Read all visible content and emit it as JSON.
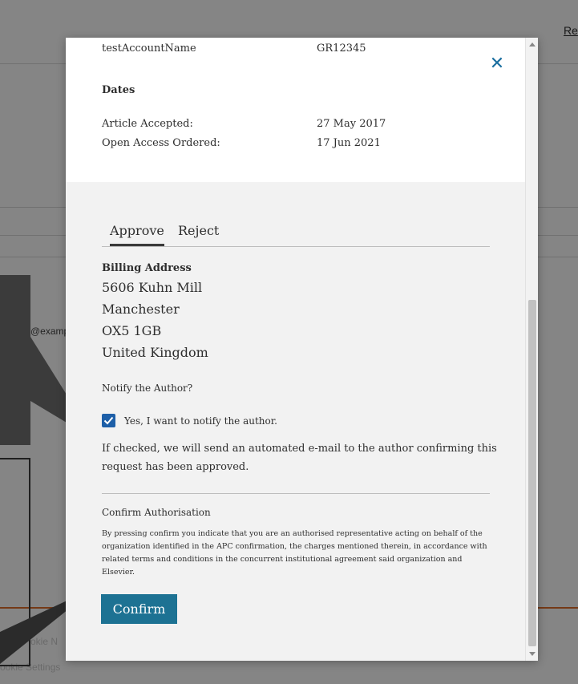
{
  "background": {
    "top_link": "Re",
    "email_fragment": "@examp",
    "cookie_notice": "okie N",
    "cookie_settings": "ookie Settings"
  },
  "modal": {
    "account_label": "testAccountName",
    "account_value": "GR12345",
    "dates_heading": "Dates",
    "article_accepted_label": "Article Accepted:",
    "article_accepted_value": "27 May 2017",
    "open_access_label": "Open Access Ordered:",
    "open_access_value": "17 Jun 2021",
    "tabs": [
      {
        "label": "Approve",
        "active": true
      },
      {
        "label": "Reject",
        "active": false
      }
    ],
    "billing_heading": "Billing Address",
    "address": [
      "5606 Kuhn Mill",
      "Manchester",
      "OX5 1GB",
      "United Kingdom"
    ],
    "notify_heading": "Notify the Author?",
    "notify_checkbox_label": "Yes, I want to notify the author.",
    "notify_checked": true,
    "notify_help_line1": "If checked, we will send an automated e-mail to the author confirming this",
    "notify_help_line2": "request has been approved.",
    "confirm_heading": "Confirm Authorisation",
    "confirm_text": "By pressing confirm you indicate that you are an authorised representative acting on behalf of the organization identified in the APC confirmation, the charges mentioned therein, in accordance with related terms and conditions in the concurrent institutional agreement said organization and Elsevier.",
    "confirm_button": "Confirm"
  },
  "icons": {
    "close": "close-icon",
    "check": "checkmark-icon"
  },
  "colors": {
    "accent": "#1d7293",
    "checkbox": "#1d5fa8",
    "close": "#1b6fa0",
    "footer_line": "#e06d2b"
  }
}
